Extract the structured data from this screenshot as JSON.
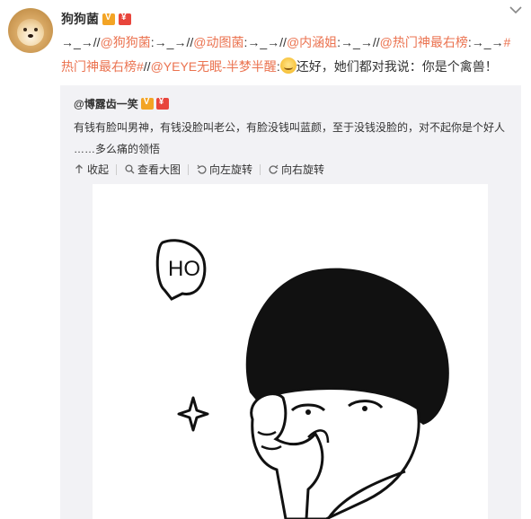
{
  "post": {
    "username": "狗狗菌",
    "icons": {
      "avatar": "shiba-avatar",
      "vip_badge": "vip-badge-icon",
      "red_badge": "red-envelope-icon",
      "more": "chevron-down-icon"
    },
    "segments": [
      {
        "text": "→_→//",
        "type": "plain"
      },
      {
        "text": "@狗狗菌",
        "type": "mention"
      },
      {
        "text": ":→_→//",
        "type": "plain"
      },
      {
        "text": "@动图菌",
        "type": "mention"
      },
      {
        "text": ":→_→//",
        "type": "plain"
      },
      {
        "text": "@内涵姐",
        "type": "mention"
      },
      {
        "text": ":→_→//",
        "type": "plain"
      },
      {
        "text": "@热门神最右榜",
        "type": "mention"
      },
      {
        "text": ":→_→",
        "type": "plain"
      },
      {
        "text": "#热门神最右榜#",
        "type": "mention"
      },
      {
        "text": "//",
        "type": "plain"
      },
      {
        "text": "@YEYE无眠-半梦半醒",
        "type": "mention"
      },
      {
        "text": ":",
        "type": "plain"
      },
      {
        "text": "",
        "type": "emoji"
      },
      {
        "text": "还好，她们都对我说：你是个禽兽！",
        "type": "plain"
      }
    ]
  },
  "repost": {
    "username": "@博露齿一笑",
    "text_line1": "有钱有脸叫男神，有钱没脸叫老公，有脸没钱叫蓝颜，至于没钱没脸的，对不起你是个好人",
    "text_line2": "……多么痛的领悟",
    "actions": [
      {
        "label": "收起",
        "icon": "collapse-up-icon"
      },
      {
        "label": "查看大图",
        "icon": "zoom-search-icon"
      },
      {
        "label": "向左旋转",
        "icon": "rotate-left-icon"
      },
      {
        "label": "向右旋转",
        "icon": "rotate-right-icon"
      }
    ],
    "image": {
      "speech_text": "HO"
    }
  },
  "colors": {
    "mention": "#eb7350",
    "repost_bg": "#f2f2f5"
  }
}
